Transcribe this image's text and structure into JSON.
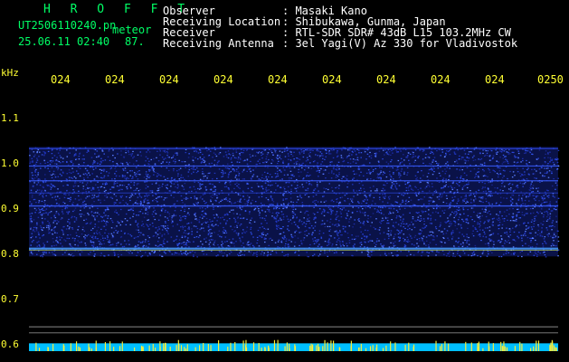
{
  "header": {
    "station": "H R O F F T",
    "filename": "UT2506110240.pn",
    "label": "meteor",
    "datetime": "25.06.11 02:40",
    "value": "87.",
    "fields": [
      {
        "label": "Observer",
        "value": ": Masaki Kano"
      },
      {
        "label": "Receiving Location",
        "value": ": Shibukawa, Gunma, Japan"
      },
      {
        "label": "Receiver",
        "value": ": RTL-SDR SDR# 43dB L15 103.2MHz CW"
      },
      {
        "label": "Receiving Antenna",
        "value": ": 3el Yagi(V) Az 330 for Vladivostok"
      }
    ]
  },
  "axis": {
    "unit": "kHz",
    "y_ticks": [
      "1.1",
      "1.0",
      "0.9",
      "0.8",
      "0.7",
      "0.6"
    ],
    "x_ticks": [
      "024",
      "024",
      "024",
      "024",
      "024",
      "024",
      "024",
      "024",
      "024",
      "0250"
    ]
  },
  "colors": {
    "background": "#000000",
    "header_green": "#00ff66",
    "header_white": "#ffffff",
    "axis_yellow": "#ffff33",
    "band": "#1e2a9a",
    "bottom_bar": "#00bfff"
  }
}
